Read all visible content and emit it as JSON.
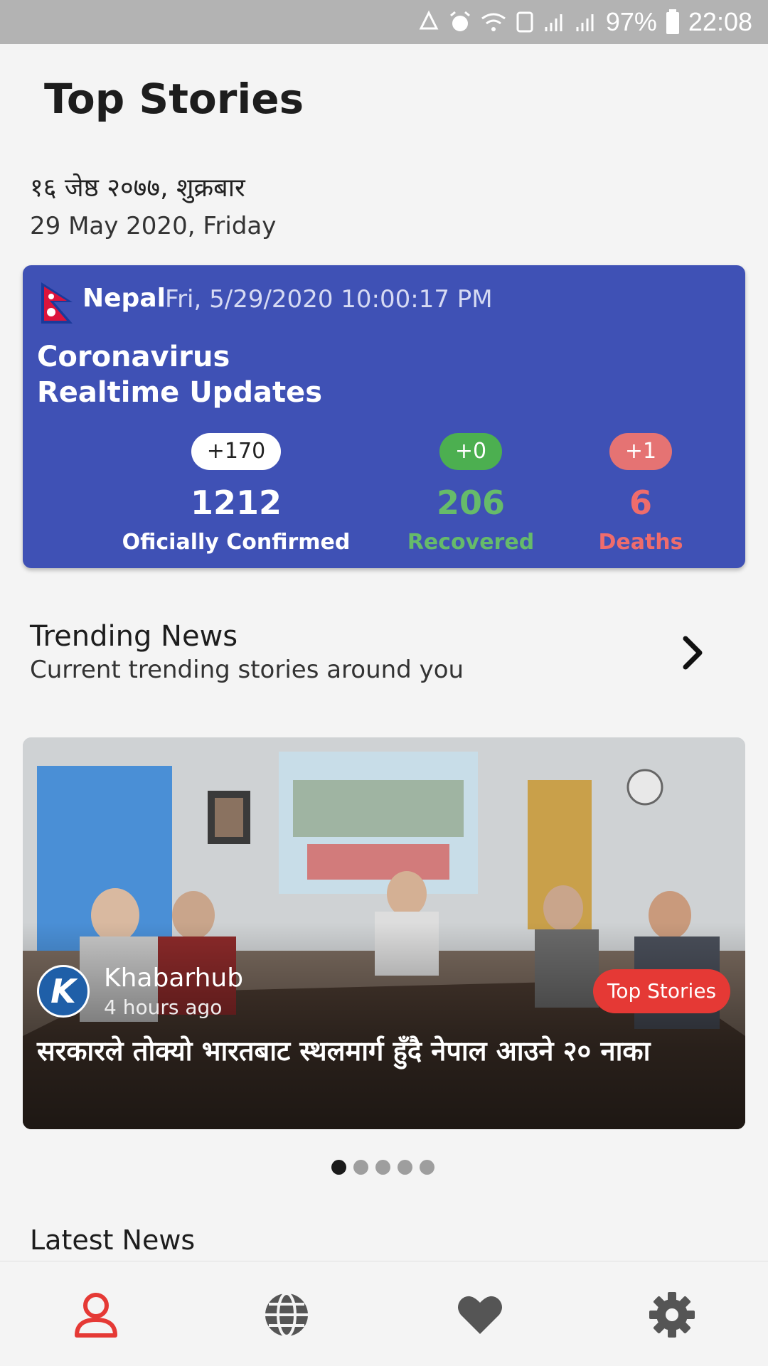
{
  "status_bar": {
    "battery": "97%",
    "time": "22:08"
  },
  "page": {
    "title": "Top Stories",
    "date_nepali": "१६ जेष्ठ २०७७, शुक्रबार",
    "date_english": "29 May 2020, Friday"
  },
  "covid": {
    "country": "Nepal",
    "updated_at": "Fri, 5/29/2020 10:00:17 PM",
    "title_line1": "Coronavirus",
    "title_line2": "Realtime Updates",
    "confirmed": {
      "delta": "+170",
      "value": "1212",
      "label": "Oficially Confirmed"
    },
    "recovered": {
      "delta": "+0",
      "value": "206",
      "label": "Recovered"
    },
    "deaths": {
      "delta": "+1",
      "value": "6",
      "label": "Deaths"
    },
    "colors": {
      "card": "#3f51b5",
      "recovered": "#66bb6a",
      "deaths": "#ef6c6c"
    }
  },
  "trending": {
    "title": "Trending News",
    "subtitle": "Current trending stories around you"
  },
  "featured_news": {
    "source": "Khabarhub",
    "time_ago": "4 hours ago",
    "category": "Top Stories",
    "headline": "सरकारले तोक्यो भारतबाट स्थलमार्ग हुँदै नेपाल आउने २० नाका",
    "logo_letter": "K"
  },
  "carousel": {
    "total": 5,
    "active_index": 0
  },
  "latest": {
    "title": "Latest News"
  },
  "bottom_nav": {
    "items": [
      "profile-icon",
      "globe-icon",
      "heart-icon",
      "gear-icon"
    ],
    "active_color": "#e53935",
    "inactive_color": "#555555"
  }
}
